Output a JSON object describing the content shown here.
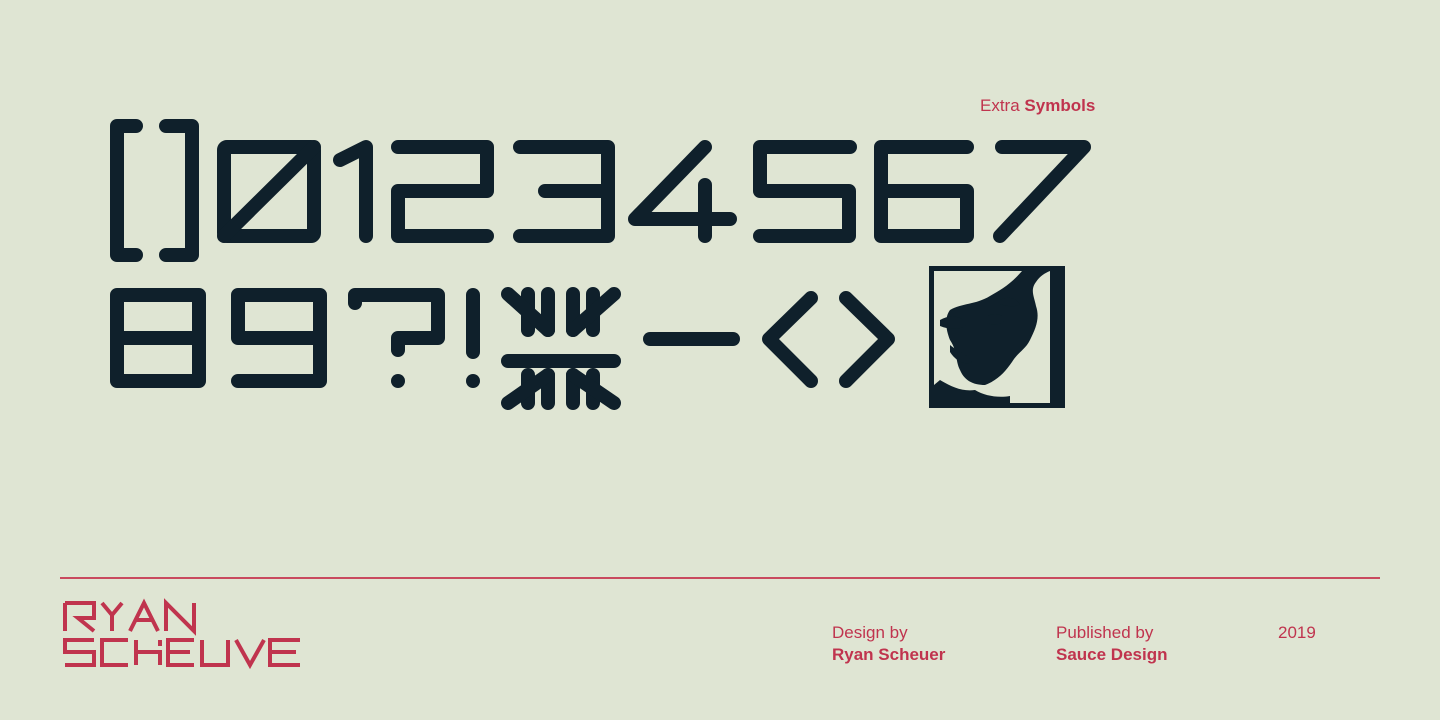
{
  "header": {
    "label_prefix": "Extra",
    "label_strong": "Symbols"
  },
  "specimen": {
    "row1": [
      "[",
      "]",
      "0",
      "1",
      "2",
      "3",
      "4",
      "5",
      "6",
      "7"
    ],
    "row2": [
      "8",
      "9",
      "?",
      "!",
      "*",
      "—",
      "<",
      ">"
    ],
    "glyph_color": "#0f202b"
  },
  "footer": {
    "logo_text": [
      "Ryan",
      "Scheuer"
    ],
    "design_by_label": "Design by",
    "designer": "Ryan Scheuer",
    "published_by_label": "Published by",
    "publisher": "Sauce Design",
    "year": "2019",
    "accent_color": "#c0344e"
  }
}
